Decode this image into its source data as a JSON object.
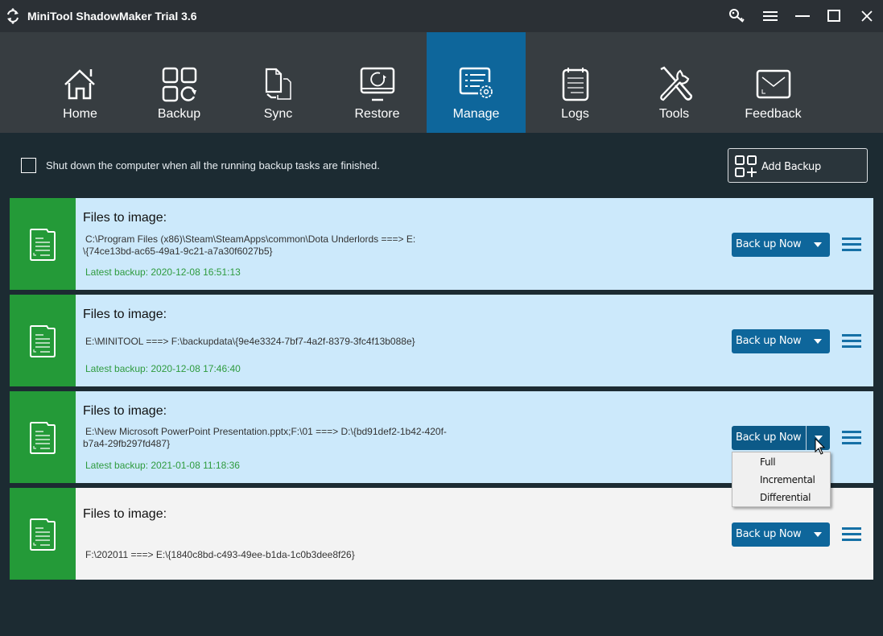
{
  "window": {
    "title": "MiniTool ShadowMaker Trial 3.6",
    "controls": [
      "key-icon",
      "menu-icon",
      "minimize-icon",
      "maximize-icon",
      "close-icon"
    ]
  },
  "nav": {
    "active": "Manage",
    "items": [
      {
        "label": "Home",
        "icon": "home-icon"
      },
      {
        "label": "Backup",
        "icon": "backup-icon"
      },
      {
        "label": "Sync",
        "icon": "sync-icon"
      },
      {
        "label": "Restore",
        "icon": "restore-icon"
      },
      {
        "label": "Manage",
        "icon": "manage-icon"
      },
      {
        "label": "Logs",
        "icon": "logs-icon"
      },
      {
        "label": "Tools",
        "icon": "tools-icon"
      },
      {
        "label": "Feedback",
        "icon": "feedback-icon"
      }
    ]
  },
  "options": {
    "shutdown_label": "Shut down the computer when all the running backup tasks are finished.",
    "shutdown_checked": false,
    "add_backup_label": "Add Backup"
  },
  "tasks": [
    {
      "title": "Files to image:",
      "path_line1": "C:\\Program Files (x86)\\Steam\\SteamApps\\common\\Dota Underlords ===> E:",
      "path_line2": "\\{74ce13bd-ac65-49a1-9c21-a7a30f6027b5}",
      "latest": "Latest backup: 2020-12-08 16:51:13",
      "button": "Back up Now"
    },
    {
      "title": "Files to image:",
      "path_line1": "E:\\MINITOOL ===> F:\\backupdata\\{9e4e3324-7bf7-4a2f-8379-3fc4f13b088e}",
      "path_line2": "",
      "latest": "Latest backup: 2020-12-08 17:46:40",
      "button": "Back up Now"
    },
    {
      "title": "Files to image:",
      "path_line1": "E:\\New Microsoft PowerPoint Presentation.pptx;F:\\01 ===> D:\\{bd91def2-1b42-420f-",
      "path_line2": "b7a4-29fb297fd487}",
      "latest": "Latest backup: 2021-01-08 11:18:36",
      "button": "Back up Now"
    },
    {
      "title": "Files to image:",
      "path_line1": "F:\\202011 ===> E:\\{1840c8bd-c493-49ee-b1da-1c0b3dee8f26}",
      "path_line2": "",
      "latest": "",
      "button": "Back up Now"
    }
  ],
  "dropdown": {
    "open_for_task": 3,
    "options": [
      "Full",
      "Incremental",
      "Differential"
    ]
  },
  "colors": {
    "titlebar": "#2b3035",
    "navbar": "#373d41",
    "nav_active": "#0e669b",
    "background": "#1c2b32",
    "card_selected": "#cce9fb",
    "card_plain": "#f3f3f3",
    "card_stripe": "#249a38",
    "latest_text": "#2e9b3e",
    "button": "#0e669b"
  }
}
